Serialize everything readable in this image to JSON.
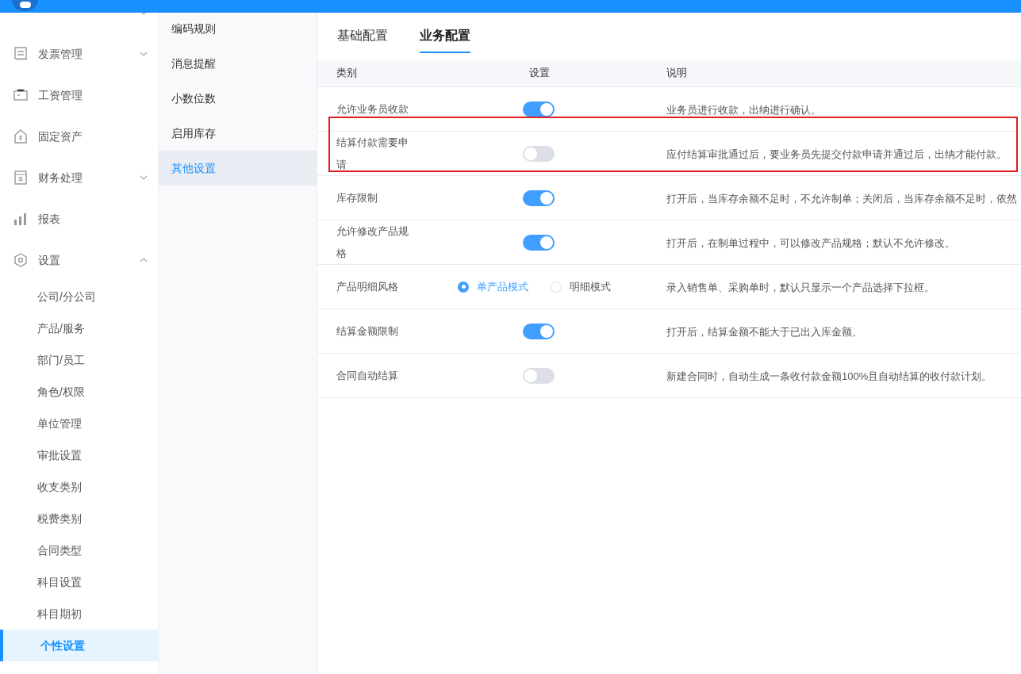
{
  "sidebar": {
    "items": [
      {
        "expanded": false
      },
      {
        "label": "发票管理",
        "expanded": false
      },
      {
        "label": "工资管理"
      },
      {
        "label": "固定资产"
      },
      {
        "label": "财务处理",
        "expanded": false
      },
      {
        "label": "报表"
      },
      {
        "label": "设置",
        "expanded": true,
        "children": [
          {
            "label": "公司/分公司",
            "selected": false
          },
          {
            "label": "产品/服务",
            "selected": false
          },
          {
            "label": "部门/员工",
            "selected": false
          },
          {
            "label": "角色/权限",
            "selected": false
          },
          {
            "label": "单位管理",
            "selected": false
          },
          {
            "label": "审批设置",
            "selected": false
          },
          {
            "label": "收支类别",
            "selected": false
          },
          {
            "label": "税费类别",
            "selected": false
          },
          {
            "label": "合同类型",
            "selected": false
          },
          {
            "label": "科目设置",
            "selected": false
          },
          {
            "label": "科目期初",
            "selected": false
          },
          {
            "label": "个性设置",
            "selected": true
          }
        ]
      }
    ]
  },
  "submenu": [
    {
      "label": "编码规则",
      "selected": false
    },
    {
      "label": "消息提醒",
      "selected": false
    },
    {
      "label": "小数位数",
      "selected": false
    },
    {
      "label": "启用库存",
      "selected": false
    },
    {
      "label": "其他设置",
      "selected": true
    }
  ],
  "tabs": [
    {
      "label": "基础配置",
      "selected": false
    },
    {
      "label": "业务配置",
      "selected": true
    }
  ],
  "table": {
    "columns": [
      "类别",
      "设置",
      "说明"
    ],
    "rows": [
      {
        "kind": "toggle",
        "category": "允许业务员收款",
        "on": true,
        "description": "业务员进行收款，出纳进行确认。"
      },
      {
        "kind": "toggle",
        "category": "结算付款需要申请",
        "on": false,
        "description": "应付结算审批通过后，要业务员先提交付款申请并通过后，出纳才能付款。",
        "highlighted": true
      },
      {
        "kind": "toggle",
        "category": "库存限制",
        "on": true,
        "description": "打开后，当库存余额不足时，不允许制单；关闭后，当库存余额不足时，依然"
      },
      {
        "kind": "toggle",
        "category": "允许修改产品规格",
        "on": true,
        "description": "打开后，在制单过程中，可以修改产品规格；默认不允许修改。"
      },
      {
        "kind": "radio",
        "category": "产品明细风格",
        "options": [
          {
            "label": "单产品模式",
            "selected": true
          },
          {
            "label": "明细模式",
            "selected": false
          }
        ],
        "description": "录入销售单、采购单时，默认只显示一个产品选择下拉框。"
      },
      {
        "kind": "toggle",
        "category": "结算金额限制",
        "on": true,
        "description": "打开后，结算金额不能大于已出入库金额。"
      },
      {
        "kind": "toggle",
        "category": "合同自动结算",
        "on": false,
        "description": "新建合同时，自动生成一条收付款金额100%且自动结算的收付款计划。"
      }
    ]
  }
}
